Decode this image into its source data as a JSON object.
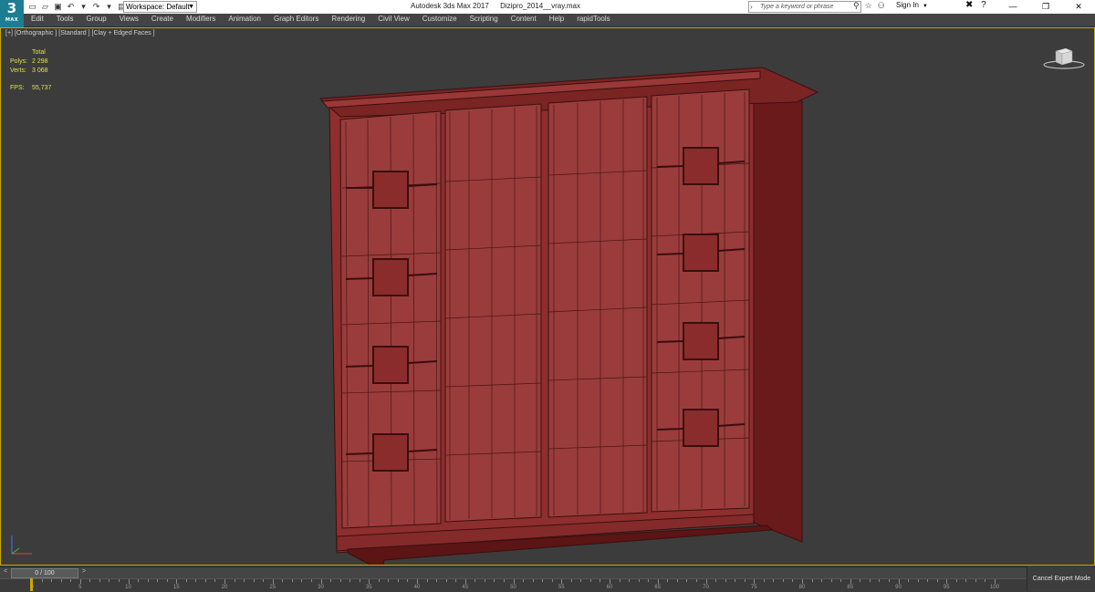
{
  "app": {
    "title": "Autodesk 3ds Max 2017",
    "file": "Dizipro_2014__vray.max",
    "logo_text": "3",
    "logo_sub": "MAX",
    "workspace": "Workspace: Default",
    "search_placeholder": "Type a keyword or phrase",
    "sign_in": "Sign In"
  },
  "menu": [
    "Edit",
    "Tools",
    "Group",
    "Views",
    "Create",
    "Modifiers",
    "Animation",
    "Graph Editors",
    "Rendering",
    "Civil View",
    "Customize",
    "Scripting",
    "Content",
    "Help",
    "rapidTools"
  ],
  "viewport": {
    "labels": [
      "[+]",
      "[Orthographic ]",
      "[Standard ]",
      "[Clay + Edged Faces ]"
    ],
    "stats": {
      "total_label": "Total",
      "polys_label": "Polys:",
      "polys": "2 298",
      "verts_label": "Verts:",
      "verts": "3 068",
      "fps_label": "FPS:",
      "fps": "55,737"
    },
    "border_color": "#c8a900",
    "model_color": "#8f2f2f"
  },
  "timeline": {
    "slider": "0 / 100",
    "prev": "<",
    "next": ">",
    "ticks": [
      "0",
      "5",
      "10",
      "15",
      "20",
      "25",
      "30",
      "35",
      "40",
      "45",
      "50",
      "55",
      "60",
      "65",
      "70",
      "75",
      "80",
      "85",
      "90",
      "95",
      "100"
    ]
  },
  "status": {
    "cancel_expert": "Cancel Expert Mode"
  }
}
